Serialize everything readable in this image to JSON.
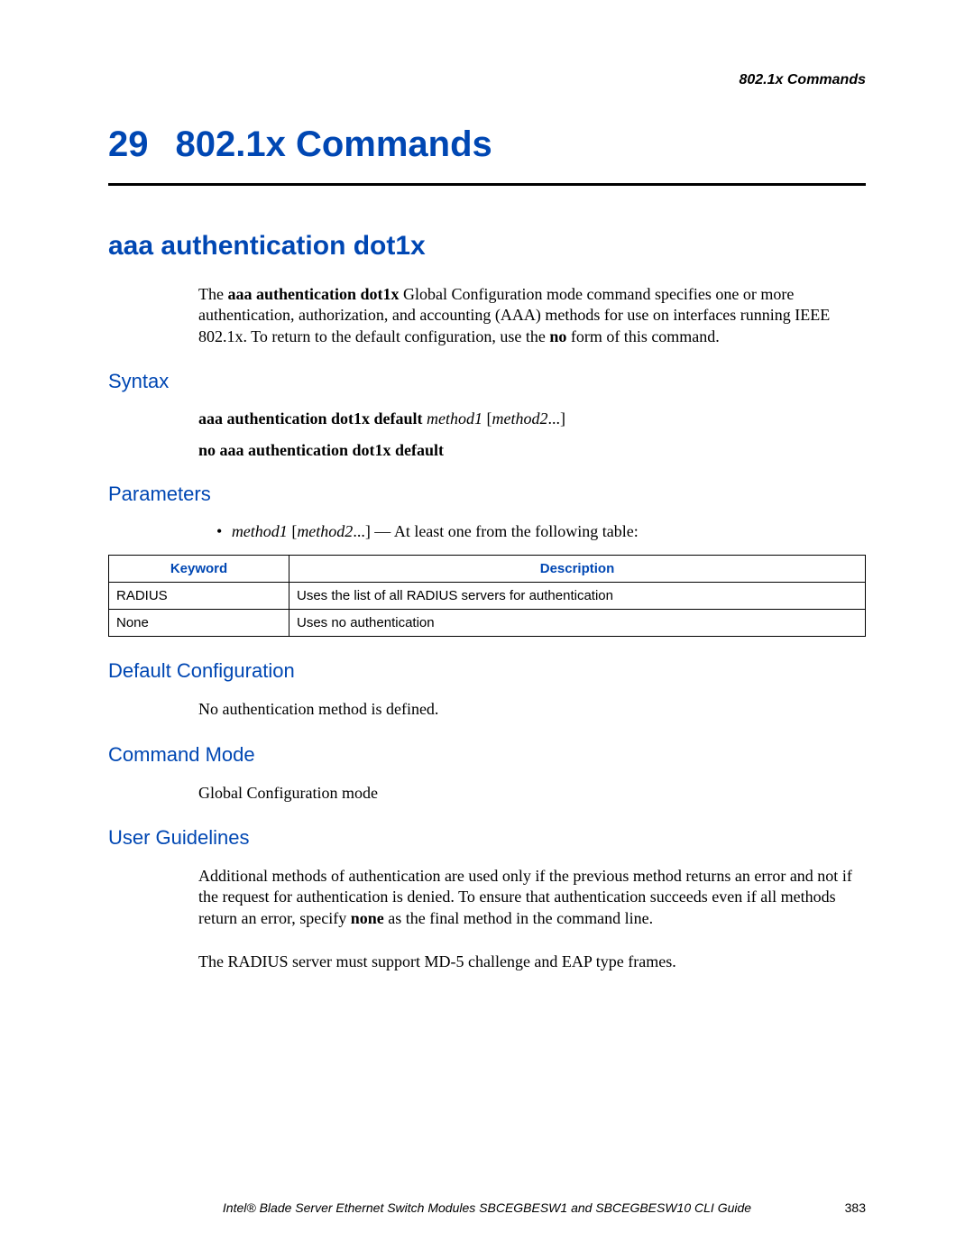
{
  "header": {
    "right": "802.1x Commands"
  },
  "chapter": {
    "number": "29",
    "title": "802.1x Commands"
  },
  "section": {
    "title": "aaa authentication dot1x"
  },
  "intro": {
    "pre": "The ",
    "bold1": "aaa authentication dot1x",
    "mid": " Global Configuration mode command specifies one or more authentication, authorization, and accounting (AAA) methods for use on interfaces running IEEE 802.1x. To return to the default configuration, use the ",
    "bold2": "no",
    "post": " form of this command."
  },
  "syntax": {
    "heading": "Syntax",
    "line1_bold": "aaa authentication dot1x default ",
    "line1_italic1": "method1",
    "line1_mid": " [",
    "line1_italic2": "method2",
    "line1_end": "...]",
    "line2": "no aaa authentication dot1x default"
  },
  "parameters": {
    "heading": "Parameters",
    "item_italic1": "method1",
    "item_mid": " [",
    "item_italic2": "method2",
    "item_end": "...] — At least one from the following table:",
    "table": {
      "headers": [
        "Keyword",
        "Description"
      ],
      "rows": [
        [
          "RADIUS",
          "Uses the list of all RADIUS servers for authentication"
        ],
        [
          "None",
          "Uses no authentication"
        ]
      ]
    }
  },
  "defaultconfig": {
    "heading": "Default Configuration",
    "text": "No authentication method is defined."
  },
  "commandmode": {
    "heading": "Command Mode",
    "text": "Global Configuration mode"
  },
  "guidelines": {
    "heading": "User Guidelines",
    "p1_pre": "Additional methods of authentication are used only if the previous method returns an error and not if the request for authentication is denied. To ensure that authentication succeeds even if all methods return an error, specify ",
    "p1_bold": "none",
    "p1_post": " as the final method in the command line.",
    "p2": "The RADIUS server must support MD-5 challenge and EAP type frames."
  },
  "footer": {
    "title": "Intel® Blade Server Ethernet Switch Modules SBCEGBESW1 and SBCEGBESW10 CLI Guide",
    "page": "383"
  }
}
